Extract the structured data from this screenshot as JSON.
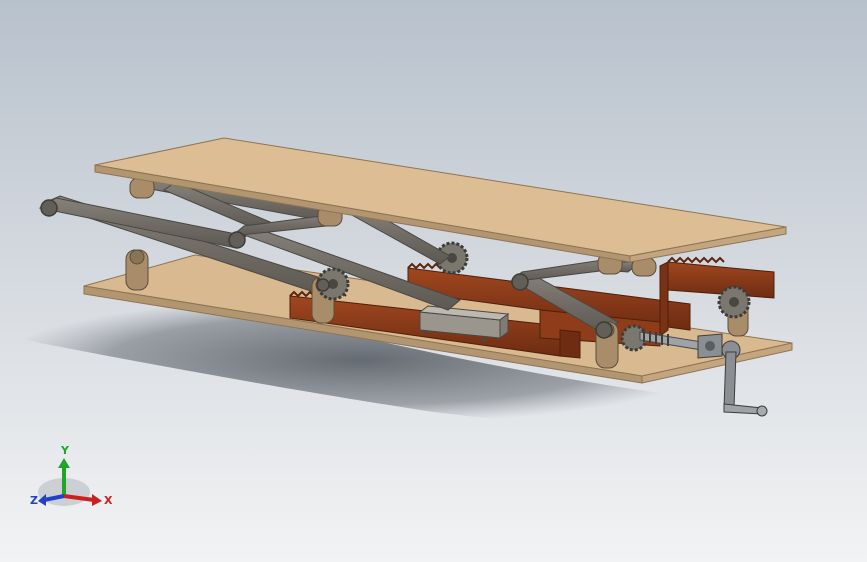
{
  "viewport": {
    "background_top": "#b7c1cc",
    "background_bottom": "#f2f3f4"
  },
  "model": {
    "plate_color": "#d7b88f",
    "plate_edge": "#a88a64",
    "link_color": "#6e6961",
    "link_edge": "#4a4742",
    "rack_color": "#8b3a1a",
    "gear_color": "#7a776f",
    "handle_color": "#8a8f93",
    "bracket_color": "#9a8062"
  },
  "triad": {
    "x_label": "X",
    "y_label": "Y",
    "z_label": "Z",
    "x_color": "#cc1f1f",
    "y_color": "#1fa52b",
    "z_color": "#2340c8"
  }
}
